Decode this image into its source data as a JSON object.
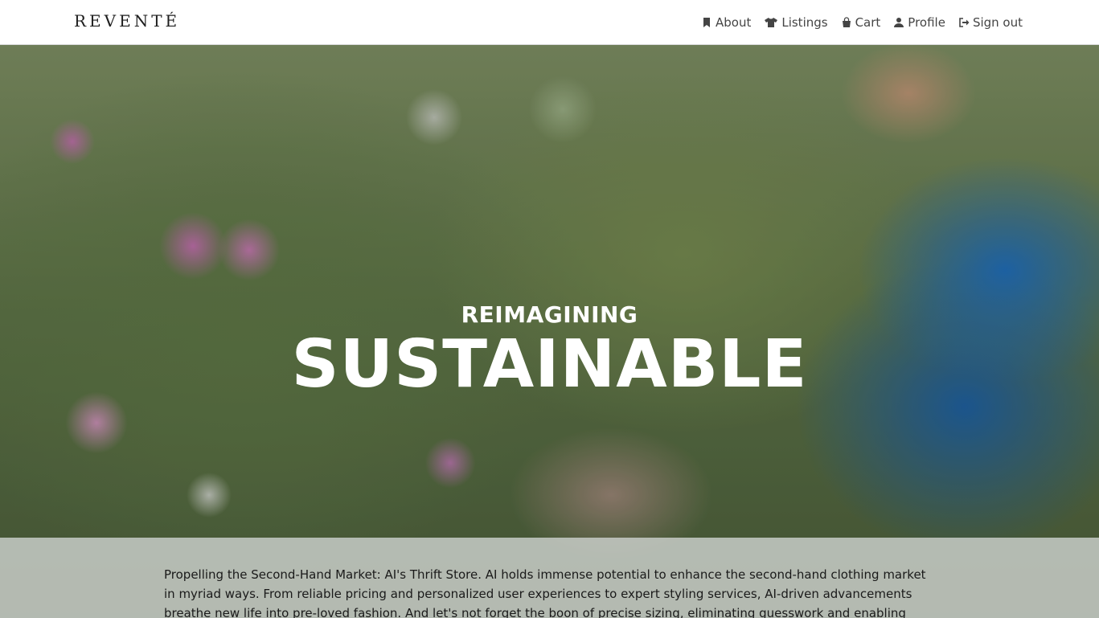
{
  "brand": {
    "logo_text": "REVENTÉ"
  },
  "nav": {
    "items": [
      {
        "label": "About",
        "icon": "bookmark-icon"
      },
      {
        "label": "Listings",
        "icon": "shirt-icon"
      },
      {
        "label": "Cart",
        "icon": "shopping-bag-icon"
      },
      {
        "label": "Profile",
        "icon": "user-icon"
      },
      {
        "label": "Sign out",
        "icon": "sign-out-icon"
      }
    ]
  },
  "hero": {
    "kicker": "REIMAGINING",
    "title": "SUSTAINABLE"
  },
  "info": {
    "text": "Propelling the Second-Hand Market: AI's Thrift Store. AI holds immense potential to enhance the second-hand clothing market in myriad ways. From reliable pricing and personalized user experiences to expert styling services, AI-driven advancements breathe new life into pre-loved fashion. And let's not forget the boon of precise sizing, eliminating guesswork and enabling customers to find their"
  }
}
